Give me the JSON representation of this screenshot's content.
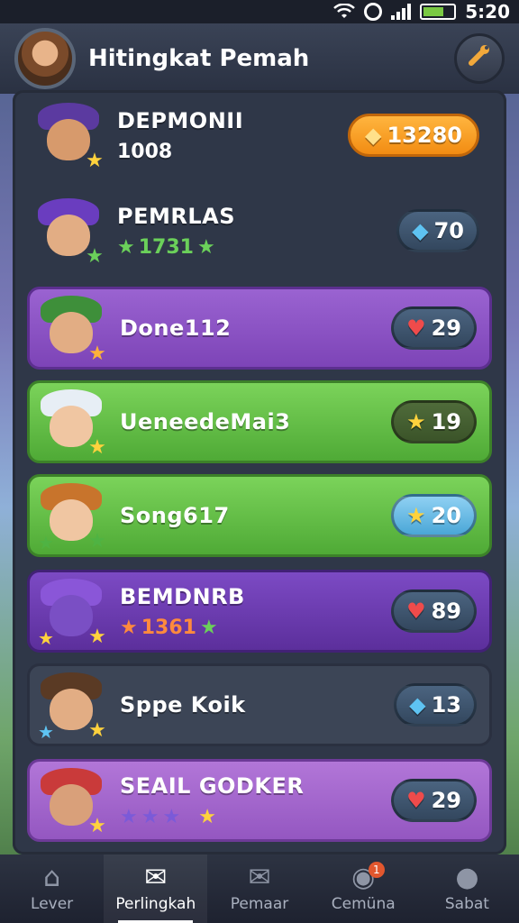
{
  "status_bar": {
    "time": "5:20"
  },
  "header": {
    "title": "Hitingkat Pemah",
    "action_icon": "wrench-icon"
  },
  "rows": [
    {
      "name": "DEPMONII",
      "sub": "1008",
      "stars_text": "",
      "value": "13280",
      "value_icon": "gold-shield",
      "style": "plain"
    },
    {
      "name": "PEMRLAS",
      "sub": "",
      "stars_text": "1731",
      "value": "70",
      "value_icon": "blue-gem",
      "style": "plain"
    },
    {
      "name": "Done112",
      "sub": "",
      "stars_text": "",
      "value": "29",
      "value_icon": "heart",
      "style": "purple"
    },
    {
      "name": "UeneedeMai3",
      "sub": "",
      "stars_text": "",
      "value": "19",
      "value_icon": "star",
      "style": "green"
    },
    {
      "name": "Song617",
      "sub": "",
      "stars_text": "",
      "value": "20",
      "value_icon": "star",
      "style": "green"
    },
    {
      "name": "BEMDNRB",
      "sub": "",
      "stars_text": "1361",
      "value": "89",
      "value_icon": "heart",
      "style": "violet"
    },
    {
      "name": "Sppe Koik",
      "sub": "",
      "stars_text": "",
      "value": "13",
      "value_icon": "blue-gem",
      "style": "dark"
    },
    {
      "name": "SEAIL GODKER",
      "sub": "",
      "stars_text": "",
      "value": "29",
      "value_icon": "heart",
      "style": "pink"
    }
  ],
  "bottom_nav": [
    {
      "label": "Lever",
      "icon": "home-icon"
    },
    {
      "label": "Perlingkah",
      "icon": "mail-icon"
    },
    {
      "label": "Pemaar",
      "icon": "inbox-icon"
    },
    {
      "label": "Cemüna",
      "icon": "chat-icon",
      "badge": "1"
    },
    {
      "label": "Sabat",
      "icon": "profile-icon"
    }
  ],
  "colors": {
    "accent_orange": "#f28c12",
    "purple": "#8a52c4",
    "green": "#5fbd43",
    "panel": "#2f3748"
  }
}
